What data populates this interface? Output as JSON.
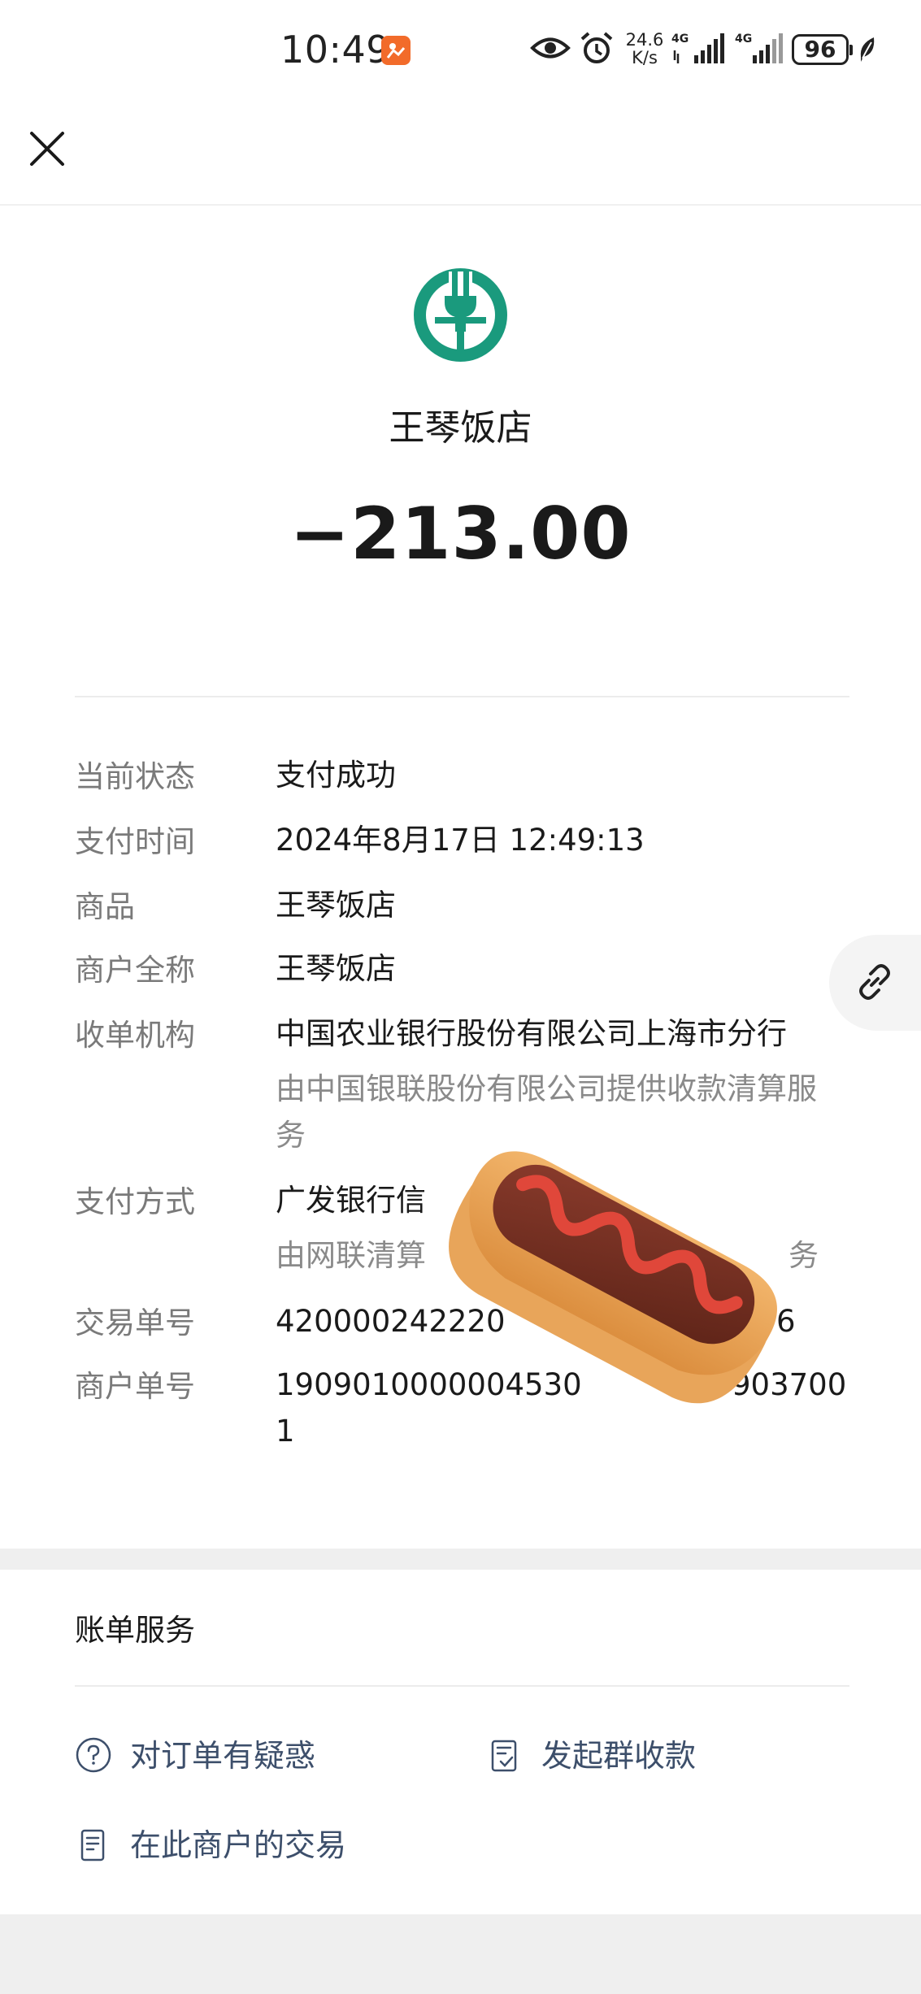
{
  "status_bar": {
    "time": "10:49",
    "net_speed_value": "24.6",
    "net_speed_unit": "K/s",
    "battery": "96"
  },
  "header": {
    "merchant_name": "王琴饭店",
    "amount": "−213.00"
  },
  "details": [
    {
      "label": "当前状态",
      "value": "支付成功"
    },
    {
      "label": "支付时间",
      "value": "2024年8月17日 12:49:13"
    },
    {
      "label": "商品",
      "value": "王琴饭店"
    },
    {
      "label": "商户全称",
      "value": "王琴饭店"
    },
    {
      "label": "收单机构",
      "value": "中国农业银行股份有限公司上海市分行",
      "sub": "由中国银联股份有限公司提供收款清算服务"
    },
    {
      "label": "支付方式",
      "value": "广发银行信",
      "sub": "由网联清算",
      "sub_tail": "务"
    },
    {
      "label": "交易单号",
      "value": "420000242220",
      "value_tail": "6"
    },
    {
      "label": "商户单号",
      "value": "1909010000004530",
      "value_tail": "903700",
      "value_line2": "1"
    }
  ],
  "services": {
    "title": "账单服务",
    "items": [
      {
        "label": "对订单有疑惑",
        "icon": "question-circle-icon"
      },
      {
        "label": "发起群收款",
        "icon": "group-collect-icon"
      },
      {
        "label": "在此商户的交易",
        "icon": "document-list-icon"
      }
    ]
  },
  "colors": {
    "brand_green": "#1a9a7d",
    "link_text": "#3d4f6b",
    "label_gray": "#7a7a7a"
  }
}
